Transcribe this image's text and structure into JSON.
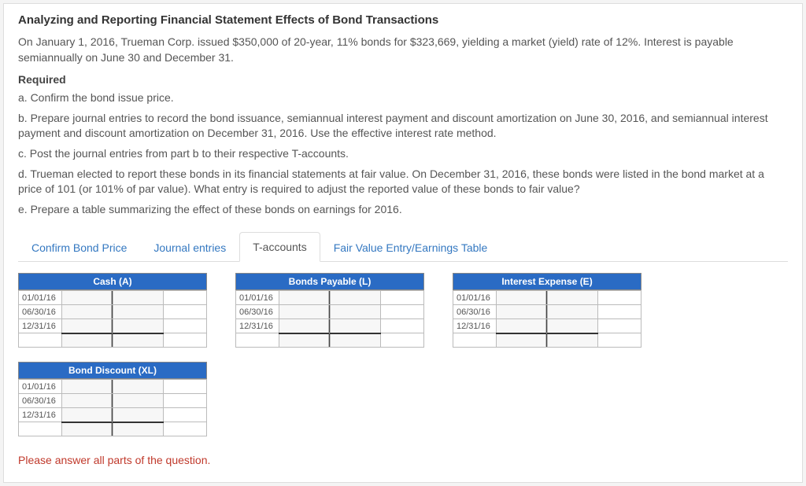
{
  "title": "Analyzing and Reporting Financial Statement Effects of Bond Transactions",
  "intro": "On January 1, 2016, Trueman Corp. issued $350,000 of 20-year, 11% bonds for $323,669, yielding a market (yield) rate of 12%. Interest is payable semiannually on June 30 and December 31.",
  "required_label": "Required",
  "req_a": "a. Confirm the bond issue price.",
  "req_b": "b. Prepare journal entries to record the bond issuance, semiannual interest payment and discount amortization on June 30, 2016, and semiannual interest payment and discount amortization on December 31, 2016. Use the effective interest rate method.",
  "req_c": "c. Post the journal entries from part b to their respective T-accounts.",
  "req_d": "d. Trueman elected to report these bonds in its financial statements at fair value. On December 31, 2016, these bonds were listed in the bond market at a price of 101 (or 101% of par value). What entry is required to adjust the reported value of these bonds to fair value?",
  "req_e": "e. Prepare a table summarizing the effect of these bonds on earnings for 2016.",
  "tabs": {
    "confirm": "Confirm Bond Price",
    "journal": "Journal entries",
    "tacc": "T-accounts",
    "fair": "Fair Value Entry/Earnings Table"
  },
  "t_accounts": {
    "cash": {
      "title": "Cash (A)",
      "dates": [
        "01/01/16",
        "06/30/16",
        "12/31/16"
      ]
    },
    "bonds_payable": {
      "title": "Bonds Payable (L)",
      "dates": [
        "01/01/16",
        "06/30/16",
        "12/31/16"
      ]
    },
    "interest_expense": {
      "title": "Interest Expense (E)",
      "dates": [
        "01/01/16",
        "06/30/16",
        "12/31/16"
      ]
    },
    "bond_discount": {
      "title": "Bond Discount (XL)",
      "dates": [
        "01/01/16",
        "06/30/16",
        "12/31/16"
      ]
    }
  },
  "warning": "Please answer all parts of the question."
}
